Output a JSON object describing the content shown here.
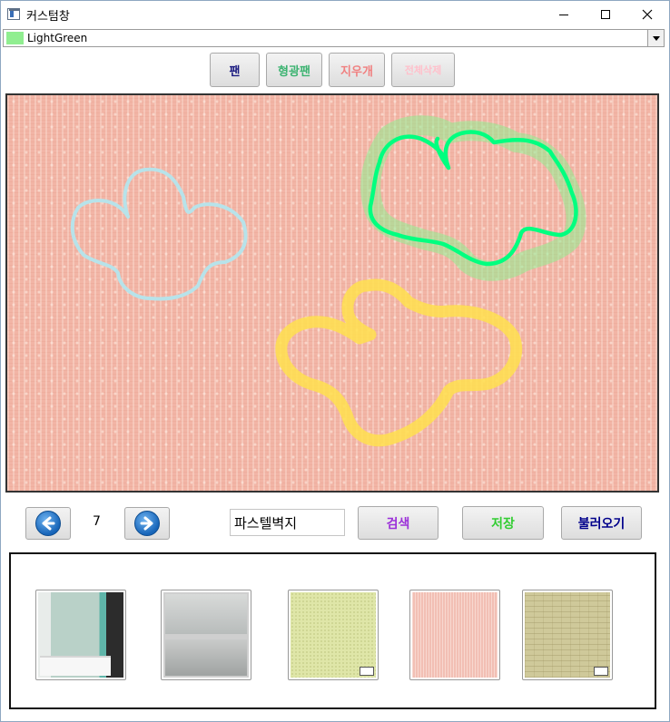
{
  "window": {
    "title": "커스텀창"
  },
  "color_picker": {
    "selected": "LightGreen",
    "swatch_color": "#90ee90"
  },
  "toolbar": {
    "pen": "팬",
    "highlighter": "형광팬",
    "eraser": "지우개",
    "clear_all": "전체삭제"
  },
  "canvas": {
    "background": "pastel-wallpaper",
    "strokes": [
      {
        "color": "#b7e3ea",
        "kind": "pen"
      },
      {
        "color": "#00ff7f",
        "kind": "pen"
      },
      {
        "color": "#90ee90",
        "kind": "highlighter"
      },
      {
        "color": "#ffe14d",
        "kind": "highlighter"
      }
    ]
  },
  "navigation": {
    "page": "7",
    "prev_icon": "arrow-left-icon",
    "next_icon": "arrow-right-icon"
  },
  "search": {
    "value": "파스텔벽지",
    "button": "검색"
  },
  "actions": {
    "save": "저장",
    "load": "불러오기"
  },
  "thumbnails": [
    {
      "name": "bathroom"
    },
    {
      "name": "glass-panels"
    },
    {
      "name": "yellow-green-wallpaper"
    },
    {
      "name": "pink-wallpaper"
    },
    {
      "name": "beige-wallpaper"
    }
  ]
}
